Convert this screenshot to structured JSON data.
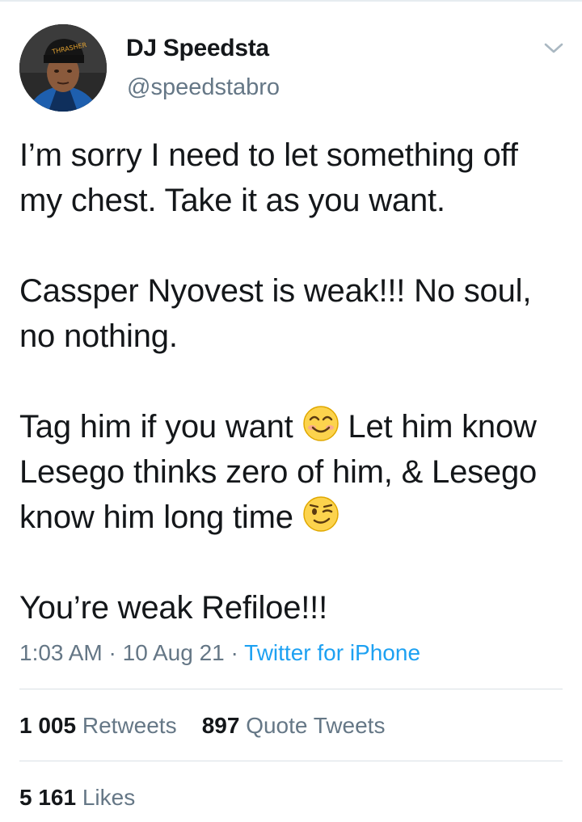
{
  "author": {
    "display_name": "DJ Speedsta",
    "handle": "@speedstabro",
    "avatar_icon": "profile-photo"
  },
  "menu_icon": "chevron-down-icon",
  "tweet": {
    "paragraph1": "I’m sorry I need to let something off my chest. Take it as you want.",
    "paragraph2": "Cassper Nyovest is weak!!! No soul, no nothing.",
    "paragraph3_a": "Tag him if you want ",
    "paragraph3_b": " Let him know Lesego thinks zero of him, & Lesego know him long time ",
    "paragraph4": "You’re weak Refiloe!!!",
    "emoji_1": "smiling-face-icon",
    "emoji_2": "winking-face-icon"
  },
  "meta": {
    "time": "1:03 AM",
    "separator": " · ",
    "date": "10 Aug 21",
    "source": "Twitter for iPhone"
  },
  "stats": {
    "retweets_count": "1 005",
    "retweets_label": "Retweets",
    "quote_count": "897",
    "quote_label": "Quote Tweets",
    "likes_count": "5 161",
    "likes_label": "Likes"
  },
  "colors": {
    "text": "#14171a",
    "secondary": "#657786",
    "link": "#1da1f2",
    "divider": "#d9e0e5"
  }
}
